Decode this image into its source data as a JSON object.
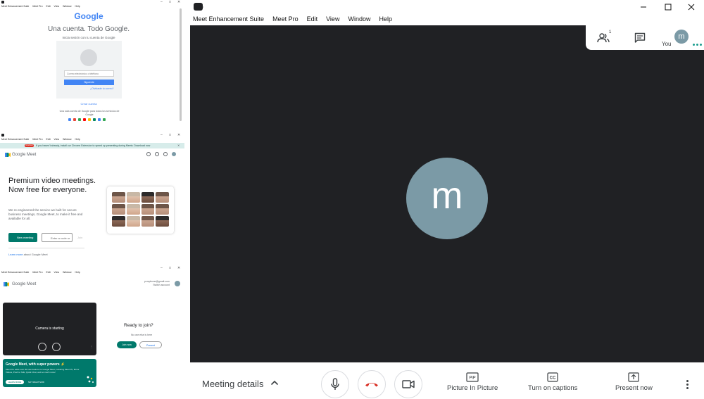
{
  "main_window": {
    "menu": [
      "Meet Enhancement Suite",
      "Meet Pro",
      "Edit",
      "View",
      "Window",
      "Help"
    ],
    "window_controls": [
      "minimize-icon",
      "maximize-icon",
      "close-icon"
    ],
    "participant_initial": "m",
    "top_panel": {
      "people_count": "1",
      "self_initial": "m",
      "self_label": "You"
    },
    "controls": {
      "meeting_details": "Meeting details",
      "picture_in_picture_icon": "PiP",
      "picture_in_picture": "Picture In Picture",
      "captions_icon": "CC",
      "captions": "Turn on captions",
      "present": "Present now"
    },
    "colors": {
      "stage": "#202124",
      "avatar": "#7b9aa6",
      "hangup": "#d93025",
      "accent": "#1a9e8f"
    }
  },
  "thumb1": {
    "menu": [
      "Meet Enhancement Suite",
      "Meet Pro",
      "Edit",
      "View",
      "Window",
      "Help"
    ],
    "logo": "Google",
    "headline": "Una cuenta. Todo Google.",
    "subtitle": "Inicia sesión con tu cuenta de Google",
    "email_placeholder": "Correo electrónico o teléfono",
    "next_button": "Siguiente",
    "forgot": "¿Olvidaste tu correo?",
    "create_account": "Crear cuenta",
    "one_account": "Una sola cuenta de Google para todos los servicios de Google"
  },
  "thumb2": {
    "menu": [
      "Meet Enhancement Suite",
      "Meet Pro",
      "Edit",
      "View",
      "Window",
      "Help"
    ],
    "banner_pill": "Important",
    "banner_text": "If you haven't already, install our Chrome Extension to speed up presenting during Meets: Download now",
    "app_name": "Google Meet",
    "hero": "Premium video meetings. Now free for everyone.",
    "description": "We re-engineered the service we built for secure business meetings, Google Meet, to make it free and available for all.",
    "new_meeting": "New meeting",
    "code_placeholder": "Enter a code or",
    "join": "Join",
    "learn_more": "Learn more",
    "learn_more_rest": "about Google Meet"
  },
  "thumb3": {
    "app_name": "Google Meet",
    "account_email": "pcmphone@gmail.com",
    "switch_account": "Switch account",
    "camera_status": "Camera is starting",
    "ready": "Ready to join?",
    "no_one": "No one else is here",
    "join_now": "Join now",
    "present": "Present",
    "promo_title": "Google Meet, with super powers ⚡",
    "promo_desc": "Meet Pro adds over 30 new features to Google Meet, including Meet JS, Mirror Videos, Push to Talk, Quick Chat, and so much more!",
    "promo_learn": "LEARN MORE",
    "promo_dismiss": "NOT RIGHT NOW"
  }
}
